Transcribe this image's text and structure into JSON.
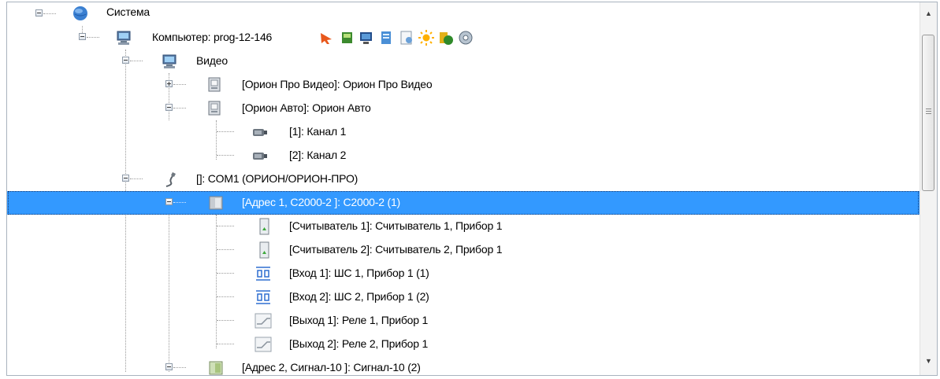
{
  "tree": {
    "items": [
      {
        "label": "Система",
        "icon": "globe-icon"
      },
      {
        "label": "Компьютер: prog-12-146",
        "icon": "computer-icon"
      },
      {
        "label": "Видео",
        "icon": "computer-icon"
      },
      {
        "label": "[Орион Про Видео]: Орион Про Видео",
        "icon": "video-server-icon"
      },
      {
        "label": "[Орион Авто]: Орион Авто",
        "icon": "video-server-icon"
      },
      {
        "label": "[1]: Канал 1",
        "icon": "camera-icon"
      },
      {
        "label": "[2]: Канал 2",
        "icon": "camera-icon"
      },
      {
        "label": "[]: COM1 (ОРИОН/ОРИОН-ПРО)",
        "icon": "com-port-icon"
      },
      {
        "label": "[Адрес 1, С2000-2 ]: С2000-2 (1)",
        "icon": "device-icon",
        "selected": true
      },
      {
        "label": "[Считыватель 1]: Считыватель 1, Прибор 1",
        "icon": "reader-icon"
      },
      {
        "label": "[Считыватель 2]: Считыватель 2, Прибор 1",
        "icon": "reader-icon"
      },
      {
        "label": "[Вход 1]: ШС 1, Прибор 1  (1)",
        "icon": "loop-input-icon"
      },
      {
        "label": "[Вход 2]: ШС 2, Прибор 1  (2)",
        "icon": "loop-input-icon"
      },
      {
        "label": "[Выход 1]: Реле 1, Прибор 1",
        "icon": "relay-icon"
      },
      {
        "label": "[Выход 2]: Реле 2, Прибор 1",
        "icon": "relay-icon"
      },
      {
        "label": "[Адрес 2, Сигнал-10 ]: Сигнал-10 (2)",
        "icon": "device-icon"
      }
    ],
    "computer_toolbar_icons": [
      "arrow-icon",
      "book-icon",
      "monitor-icon",
      "document-icon",
      "report-icon",
      "sun-icon",
      "coins-icon",
      "disk-icon"
    ]
  },
  "colors": {
    "selection": "#3399ff",
    "tree_lines": "#9a9a9a"
  },
  "scrollbar": {
    "up_arrow": "▲",
    "down_arrow": "▼"
  }
}
